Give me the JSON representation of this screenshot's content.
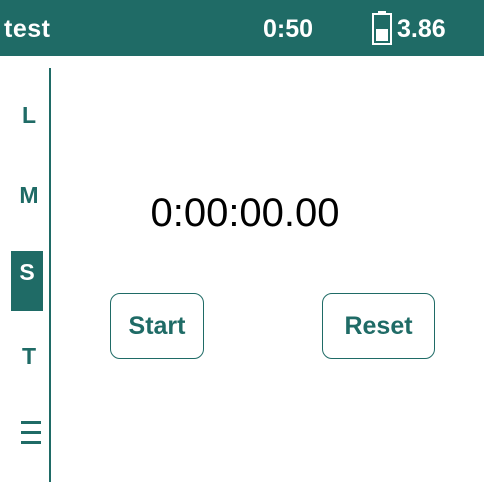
{
  "status_bar": {
    "title": "test",
    "time": "0:50",
    "battery_value": "3.86",
    "battery_icon": "battery-icon"
  },
  "side_menu": {
    "items": [
      {
        "label": "L",
        "active": false
      },
      {
        "label": "M",
        "active": false
      },
      {
        "label": "S",
        "active": true
      },
      {
        "label": "T",
        "active": false
      }
    ],
    "menu_icon": "hamburger-menu-icon"
  },
  "stopwatch": {
    "display": "0:00:00.00",
    "start_label": "Start",
    "reset_label": "Reset"
  },
  "colors": {
    "accent": "#1f6b66",
    "background": "#ffffff",
    "text": "#000000"
  }
}
